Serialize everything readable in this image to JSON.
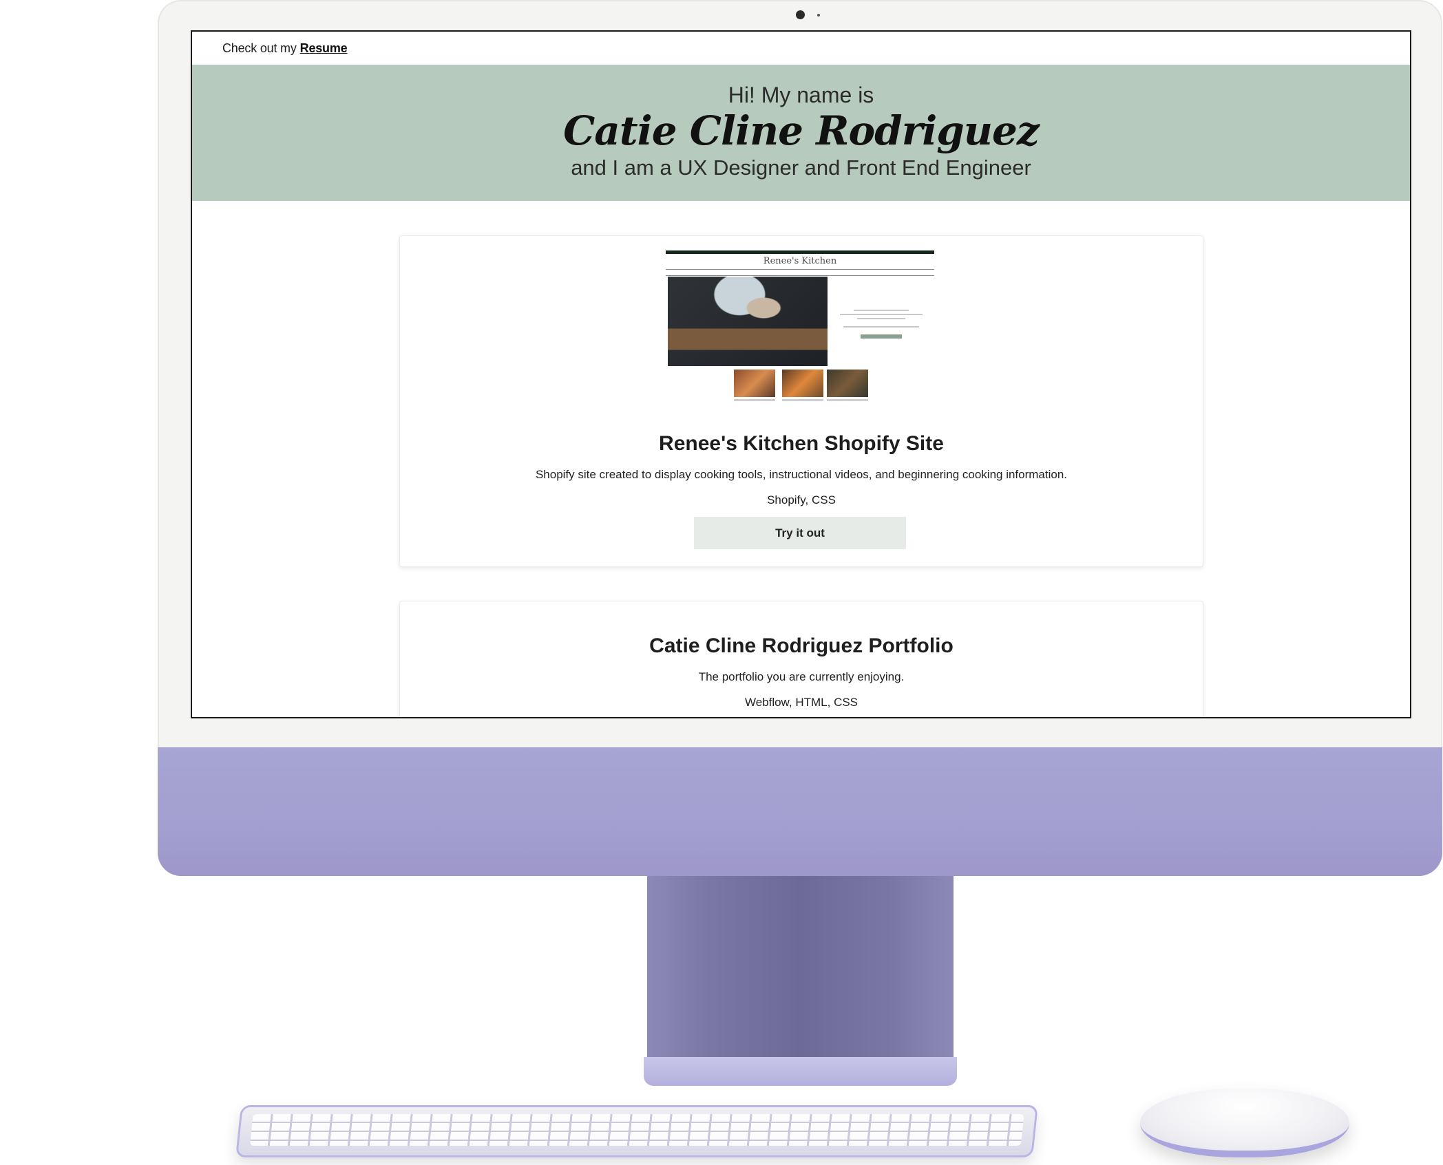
{
  "topbar": {
    "text": "Check out my",
    "link_label": "Resume"
  },
  "hero": {
    "greeting": "Hi! My name is",
    "name": "Catie Cline Rodriguez",
    "role": "and I am a UX Designer and Front End Engineer"
  },
  "projects": [
    {
      "thumbnail_title": "Renee's Kitchen",
      "title": "Renee's Kitchen Shopify Site",
      "description": "Shopify site created to display cooking tools, instructional videos, and beginnering cooking information.",
      "tech": "Shopify, CSS",
      "button_label": "Try it out"
    },
    {
      "title": "Catie Cline Rodriguez Portfolio",
      "description": "The portfolio you are currently enjoying.",
      "tech": "Webflow, HTML, CSS"
    }
  ],
  "colors": {
    "hero_bg": "#b7cabe",
    "button_bg": "#e6ebe7",
    "imac_purple": "#a7a5d3"
  }
}
